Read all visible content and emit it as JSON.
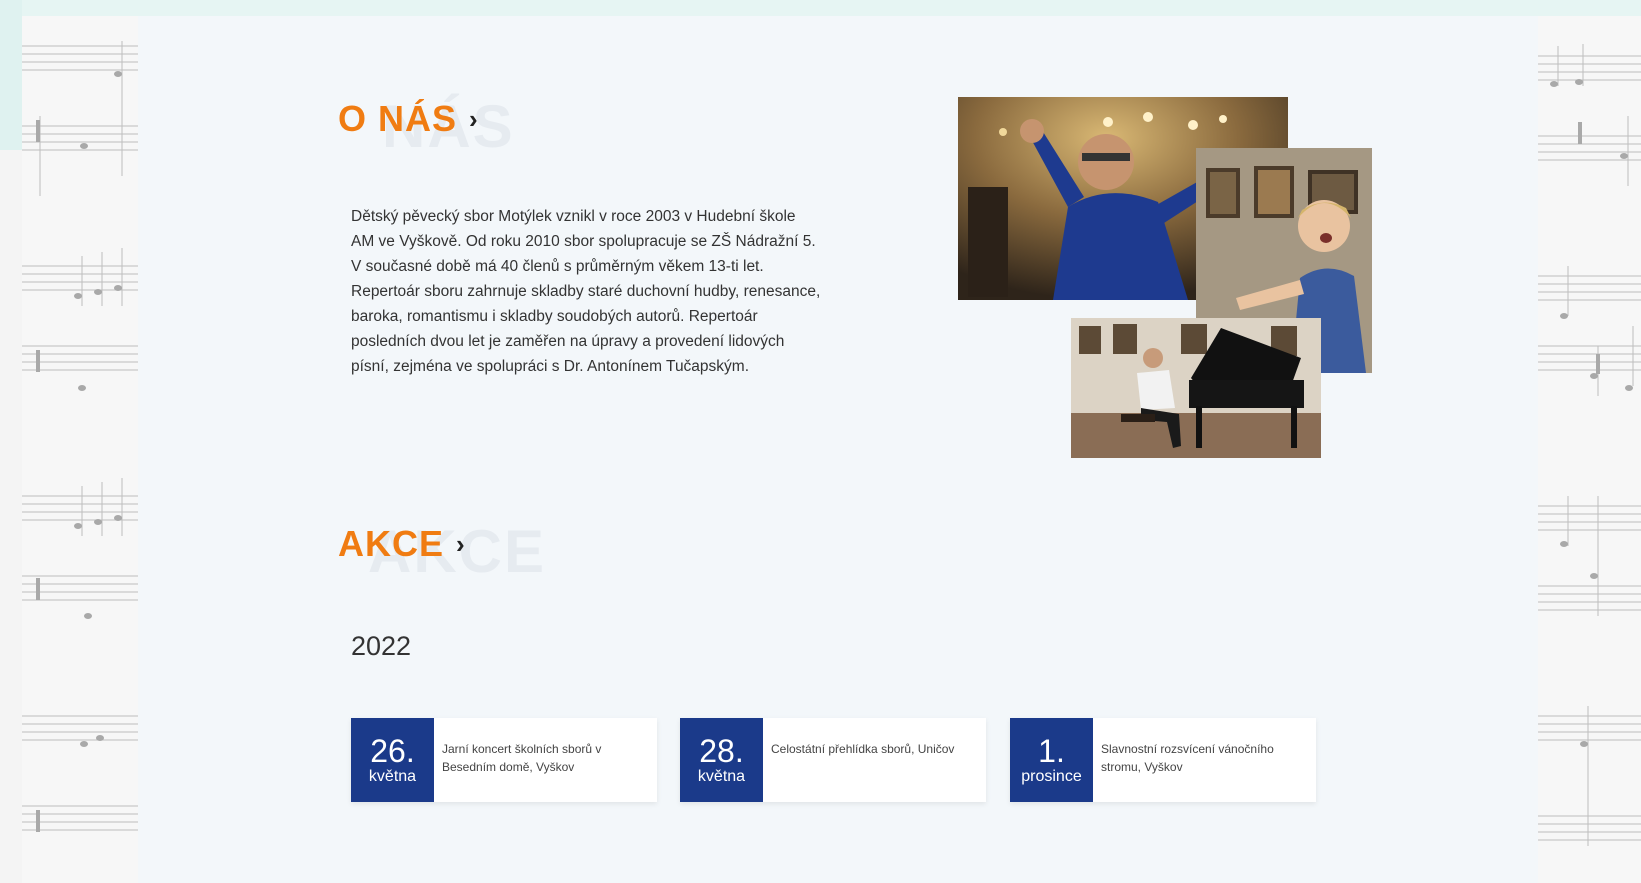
{
  "about": {
    "heading": "O NÁS",
    "heading_ghost": "NÁS",
    "text": "Dětský pěvecký sbor Motýlek vznikl v roce 2003 v Hudební škole AM ve Vyškově. Od roku 2010 sbor spolupracuje se ZŠ Nádražní 5. V současné době má 40 členů s průměrným věkem 13-ti let. Repertoár sboru zahrnuje skladby staré duchovní hudby, renesance, baroka, romantismu i skladby soudobých autorů. Repertoár posledních dvou let je zaměřen na úpravy a provedení lidových písní, zejména ve spolupráci s Dr. Antonínem Tučapským."
  },
  "events": {
    "heading": "AKCE",
    "heading_ghost": "AKCE",
    "year": "2022",
    "items": [
      {
        "day": "26.",
        "month": "května",
        "description": "Jarní koncert školních sborů v Besedním domě, Vyškov"
      },
      {
        "day": "28.",
        "month": "května",
        "description": "Celostátní přehlídka sborů, Uničov"
      },
      {
        "day": "1.",
        "month": "prosince",
        "description": "Slavnostní rozsvícení vánočního stromu, Vyškov"
      }
    ]
  },
  "icons": {
    "chevron": "chevron-right-icon"
  },
  "colors": {
    "accent": "#f07c12",
    "date_block": "#1b3a8a",
    "panel": "#f3f7fa",
    "page": "#e6f5f3"
  }
}
